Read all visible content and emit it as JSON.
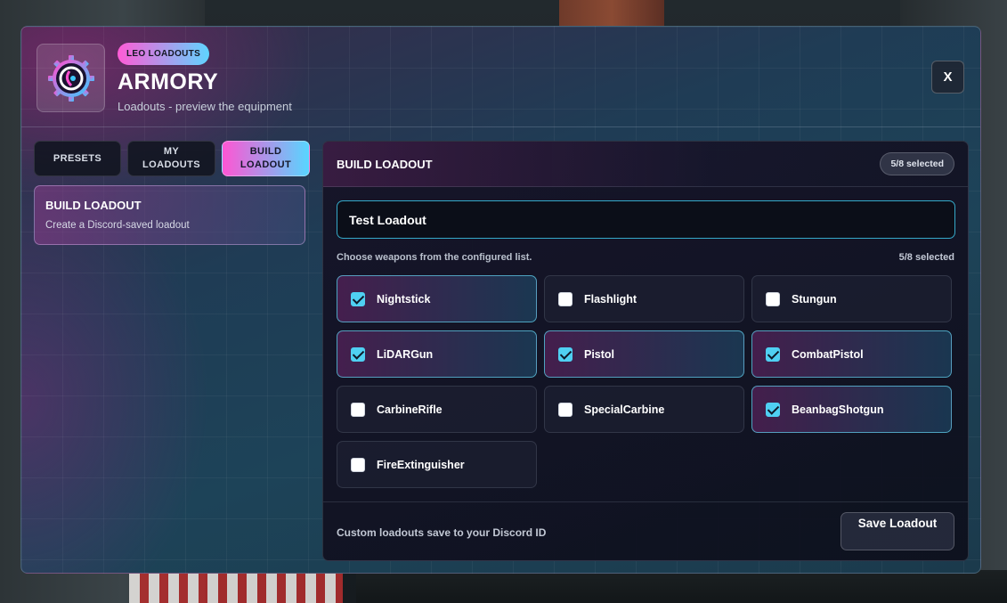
{
  "header": {
    "badge": "LEO LOADOUTS",
    "title": "ARMORY",
    "subtitle": "Loadouts - preview the equipment",
    "close_label": "X"
  },
  "tabs": [
    {
      "label": "PRESETS",
      "active": false
    },
    {
      "label": "MY LOADOUTS",
      "active": false
    },
    {
      "label": "BUILD LOADOUT",
      "active": true
    }
  ],
  "side_card": {
    "title": "BUILD LOADOUT",
    "subtitle": "Create a Discord-saved loadout"
  },
  "builder": {
    "title": "BUILD LOADOUT",
    "selected_badge": "5/8 selected",
    "loadout_name": "Test Loadout",
    "hint": "Choose weapons from the configured list.",
    "hint_count": "5/8 selected",
    "weapons": [
      {
        "label": "Nightstick",
        "checked": true
      },
      {
        "label": "Flashlight",
        "checked": false
      },
      {
        "label": "Stungun",
        "checked": false
      },
      {
        "label": "LiDARGun",
        "checked": true
      },
      {
        "label": "Pistol",
        "checked": true
      },
      {
        "label": "CombatPistol",
        "checked": true
      },
      {
        "label": "CarbineRifle",
        "checked": false
      },
      {
        "label": "SpecialCarbine",
        "checked": false
      },
      {
        "label": "BeanbagShotgun",
        "checked": true
      },
      {
        "label": "FireExtinguisher",
        "checked": false
      }
    ],
    "footer_note": "Custom loadouts save to your Discord ID",
    "save_label": "Save Loadout"
  },
  "colors": {
    "accent_pink": "#ff55d3",
    "accent_cyan": "#57d6ff",
    "checkbox_checked": "#4fd0f2"
  },
  "icons": {
    "logo": "cyber-gear-logo-icon",
    "close": "close-icon",
    "checkbox": "checkbox-icon"
  }
}
